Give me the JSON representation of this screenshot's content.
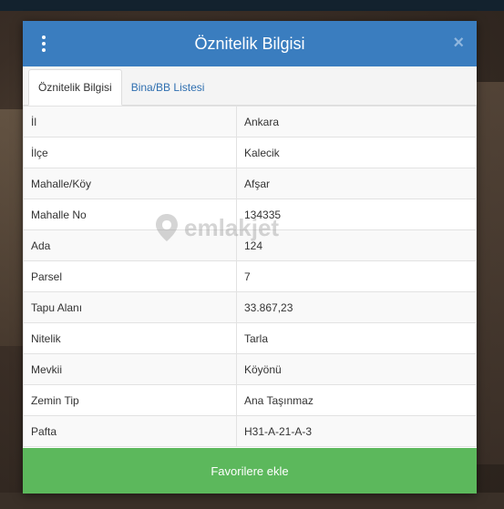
{
  "modal": {
    "title": "Öznitelik Bilgisi",
    "close_label": "×"
  },
  "tabs": [
    {
      "label": "Öznitelik Bilgisi",
      "active": true
    },
    {
      "label": "Bina/BB Listesi",
      "active": false
    }
  ],
  "rows": [
    {
      "key": "İl",
      "value": "Ankara"
    },
    {
      "key": "İlçe",
      "value": "Kalecik"
    },
    {
      "key": "Mahalle/Köy",
      "value": "Afşar"
    },
    {
      "key": "Mahalle No",
      "value": "134335"
    },
    {
      "key": "Ada",
      "value": "124"
    },
    {
      "key": "Parsel",
      "value": "7"
    },
    {
      "key": "Tapu Alanı",
      "value": "33.867,23"
    },
    {
      "key": "Nitelik",
      "value": "Tarla"
    },
    {
      "key": "Mevkii",
      "value": "Köyönü"
    },
    {
      "key": "Zemin Tip",
      "value": "Ana Taşınmaz"
    },
    {
      "key": "Pafta",
      "value": "H31-A-21-A-3"
    }
  ],
  "favorite_button": "Favorilere ekle",
  "watermark": "emlakjet",
  "colors": {
    "header": "#3a7dbf",
    "button": "#5cb85c",
    "tab_inactive": "#2f6fb0"
  }
}
